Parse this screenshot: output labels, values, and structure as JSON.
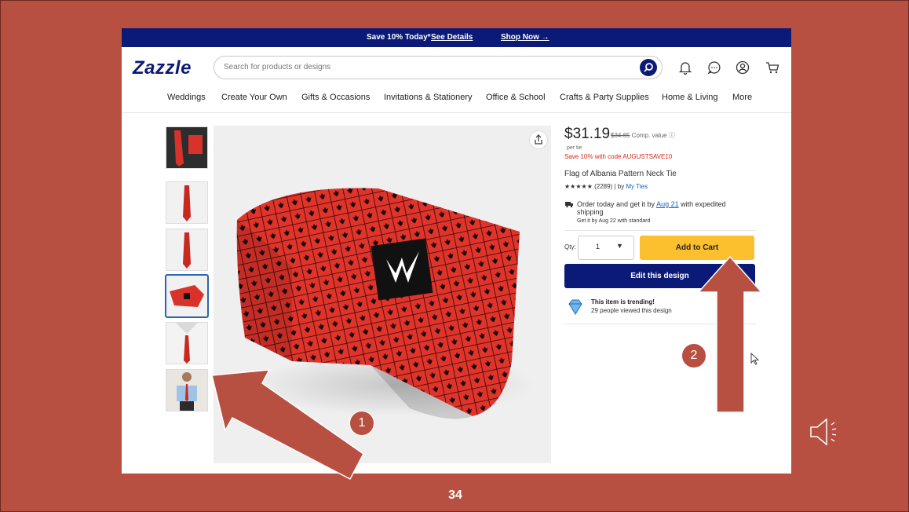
{
  "promo": {
    "text": "Save 10% Today*",
    "details": "See Details",
    "shop": "Shop Now →"
  },
  "header": {
    "logo": "Zazzle",
    "search_placeholder": "Search for products or designs"
  },
  "nav": [
    "Weddings",
    "Create Your Own",
    "Gifts & Occasions",
    "Invitations & Stationery",
    "Office & School",
    "Crafts & Party Supplies",
    "Home & Living",
    "More"
  ],
  "product": {
    "price": "$31.19",
    "old_price": "$34.65",
    "comp_value": "Comp. value",
    "per": "per tie",
    "save_code": "Save 10% with code AUGUSTSAVE10",
    "title": "Flag of Albania Pattern Neck Tie",
    "stars": "★★★★★",
    "reviews": "(2289) | by",
    "seller": "My Ties",
    "ship_pre": "Order today and get it by",
    "ship_date": "Aug 21",
    "ship_post": "with expedited shipping",
    "ship_standard": "Get it by Aug 22 with standard",
    "qty_label": "Qty:",
    "qty_value": "1",
    "add_to_cart": "Add to Cart",
    "edit_design": "Edit this design",
    "trending_title": "This item is trending!",
    "trending_sub": "29 people viewed this design"
  },
  "annotations": {
    "one": "1",
    "two": "2"
  },
  "slide": {
    "page_number": "34"
  },
  "colors": {
    "navy": "#0b1a77",
    "cart_yellow": "#fcbf2e",
    "slide_bg": "#b85042",
    "tie_red": "#e0342b"
  }
}
